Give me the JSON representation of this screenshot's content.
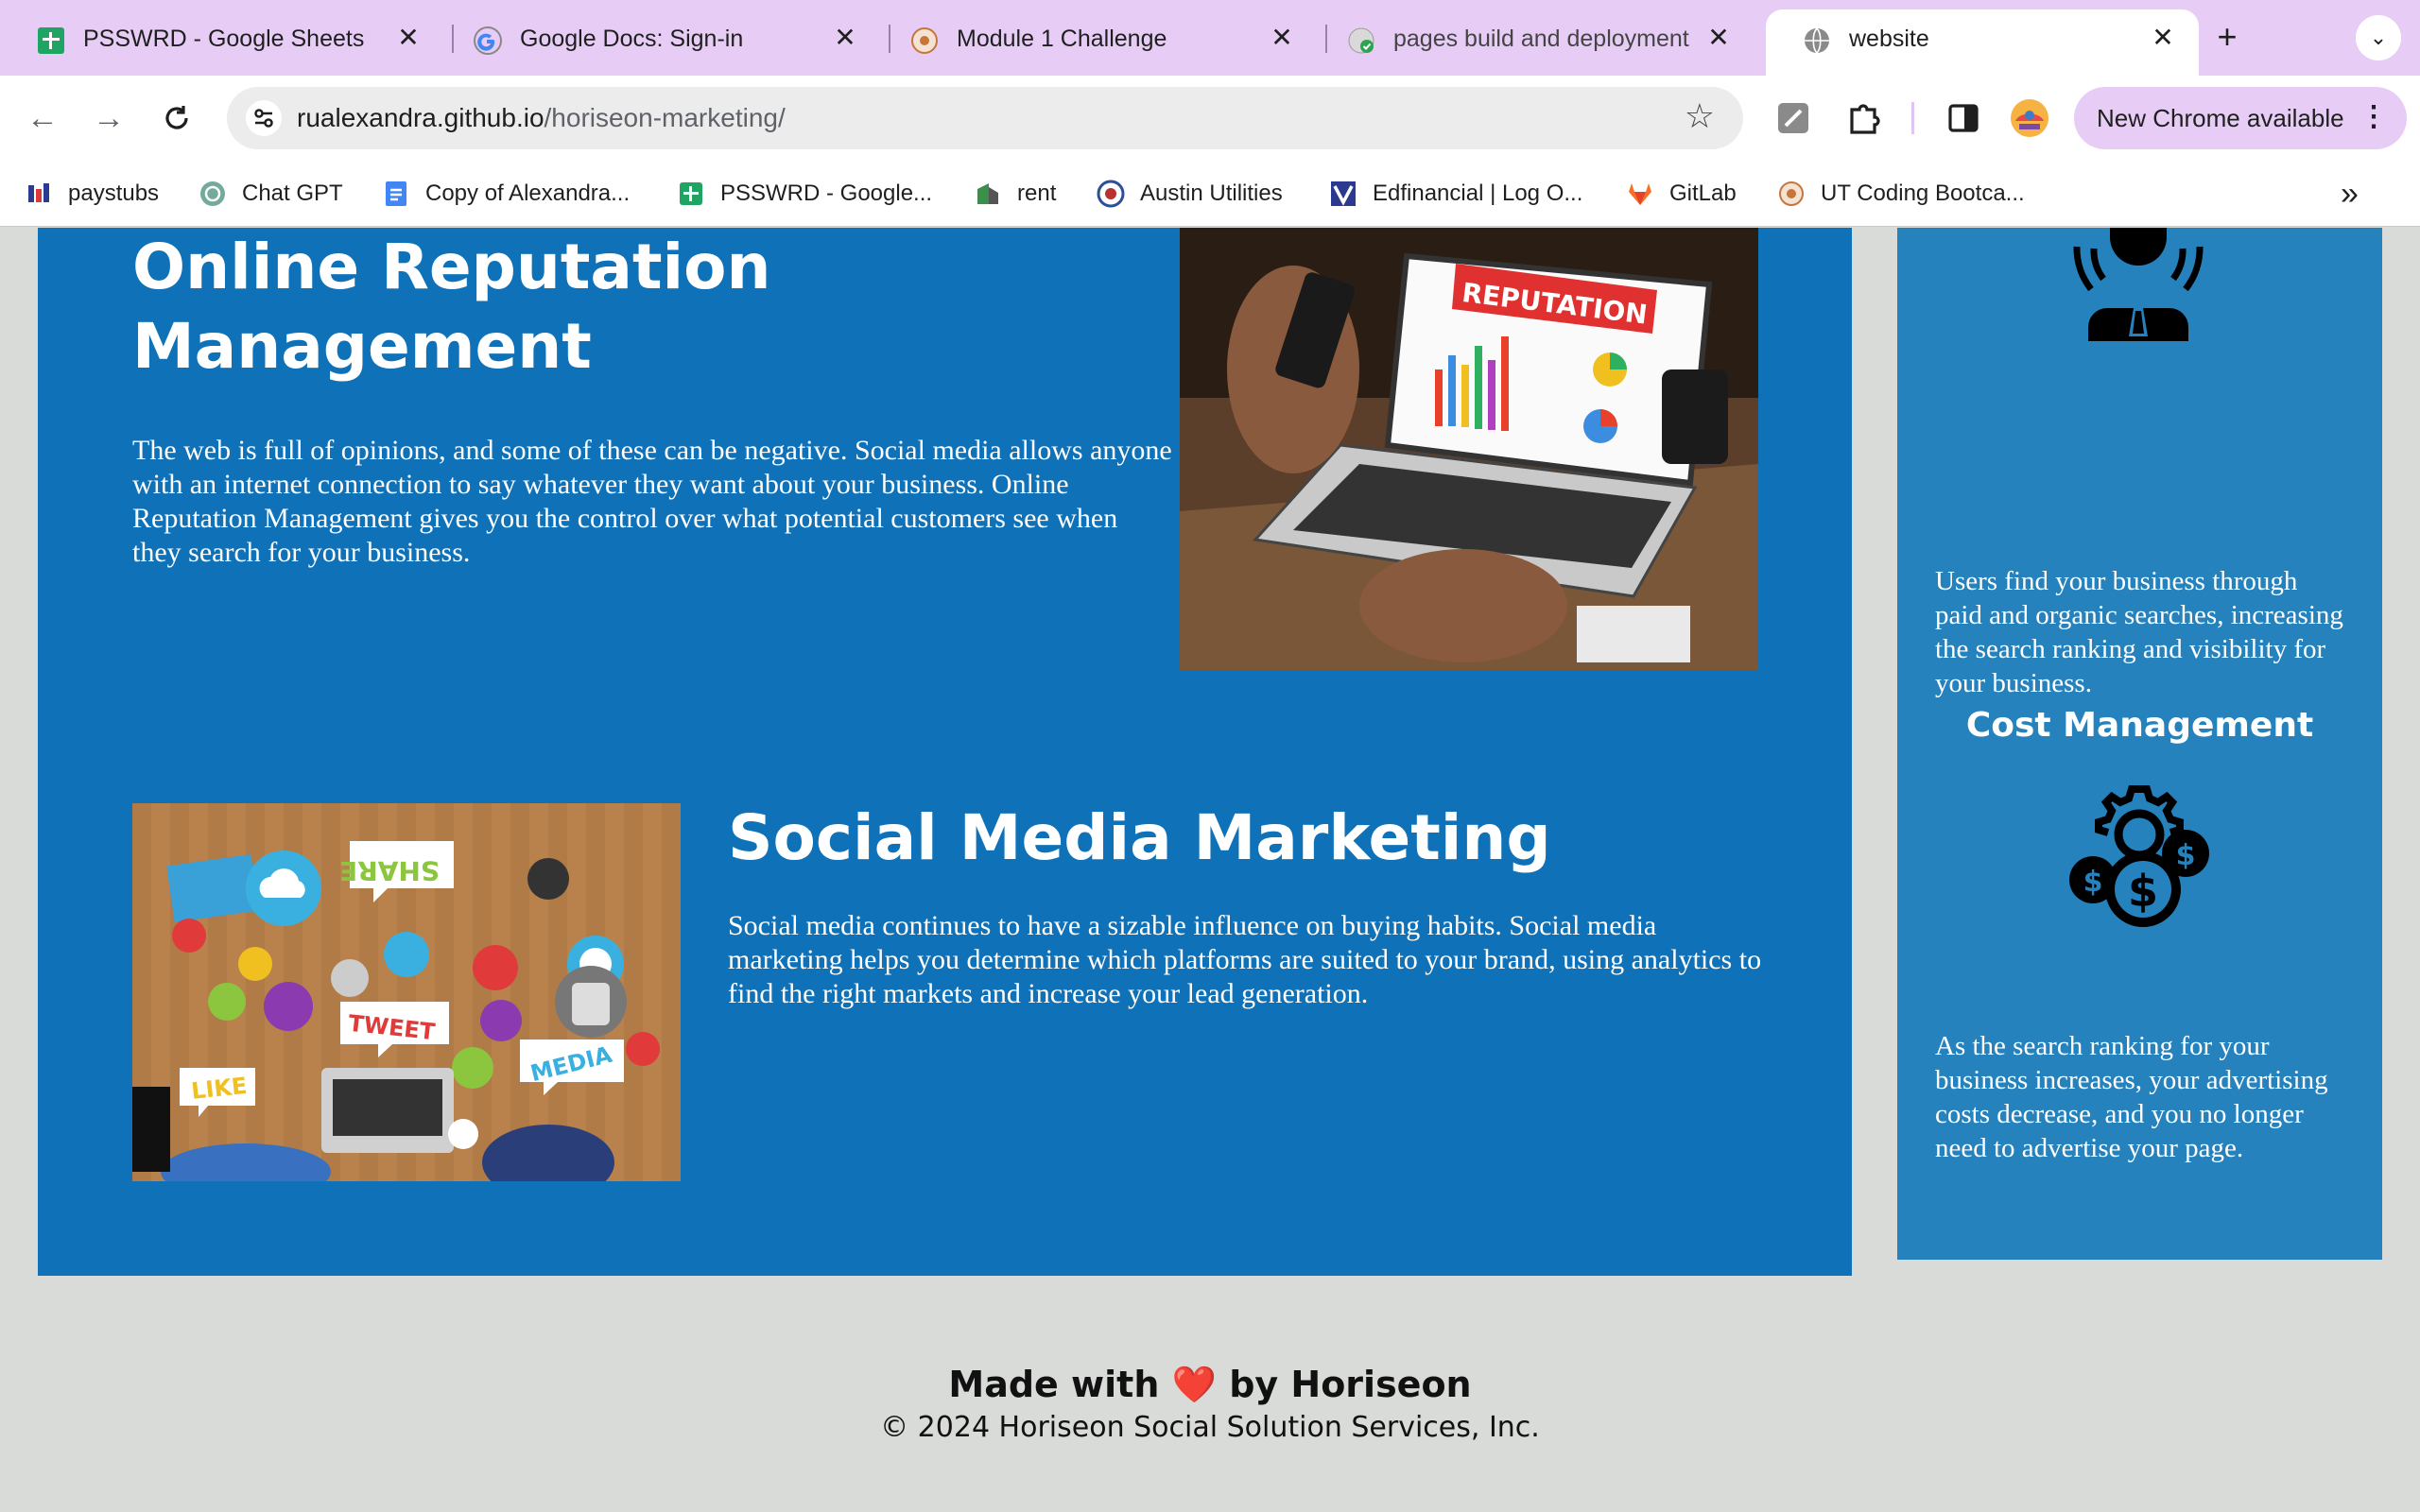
{
  "browser": {
    "tabs": [
      {
        "title": "PSSWRD - Google Sheets",
        "icon": "google-sheets-icon"
      },
      {
        "title": "Google Docs: Sign-in",
        "icon": "google-icon"
      },
      {
        "title": "Module 1 Challenge",
        "icon": "bootcamp-icon"
      },
      {
        "title": "pages build and deployment",
        "icon": "github-icon"
      },
      {
        "title": "website",
        "icon": "globe-icon",
        "active": true
      }
    ],
    "new_tab": "+",
    "url_host": "rualexandra.github.io",
    "url_path": "/horiseon-marketing/",
    "update_label": "New Chrome available",
    "bookmarks": [
      {
        "label": "paystubs",
        "icon": "paystubs-icon"
      },
      {
        "label": "Chat GPT",
        "icon": "chatgpt-icon"
      },
      {
        "label": "Copy of Alexandra...",
        "icon": "google-docs-icon"
      },
      {
        "label": "PSSWRD - Google...",
        "icon": "google-sheets-icon"
      },
      {
        "label": "rent",
        "icon": "rent-icon"
      },
      {
        "label": "Austin Utilities",
        "icon": "austin-seal-icon"
      },
      {
        "label": "Edfinancial | Log O...",
        "icon": "edfinancial-icon"
      },
      {
        "label": "GitLab",
        "icon": "gitlab-icon"
      },
      {
        "label": "UT Coding Bootca...",
        "icon": "bootcamp-icon"
      }
    ]
  },
  "page": {
    "services": {
      "online_reputation": {
        "title": "Online Reputation Management",
        "body": "The web is full of opinions, and some of these can be negative. Social media allows anyone with an internet connection to say whatever they want about your business. Online Reputation Management gives you the control over what potential customers see when they search for your business.",
        "image_text": "REPUTATION"
      },
      "social_media": {
        "title": "Social Media Marketing",
        "body": "Social media continues to have a sizable influence on buying habits. Social media marketing helps you determine which platforms are suited to your brand, using analytics to find the right markets and increase your lead generation.",
        "image_words": [
          "SHARE",
          "TWEET",
          "LIKE",
          "MEDIA"
        ]
      }
    },
    "benefits": {
      "brand_text": "Users find your business through paid and organic searches, increasing the search ranking and visibility for your business.",
      "cost_heading": "Cost Management",
      "cost_text": "As the search ranking for your business increases, your advertising costs decrease, and you no longer need to advertise your page."
    },
    "footer": {
      "made_prefix": "Made with",
      "heart": "❤️",
      "made_suffix": "by Horiseon",
      "copyright": "© 2024 Horiseon Social Solution Services, Inc."
    }
  },
  "colors": {
    "service_bg": "#0f72b8",
    "benefits_bg": "#2582bd",
    "page_bg": "#d9dbd8",
    "tabstrip_bg": "#e7cdf6"
  }
}
